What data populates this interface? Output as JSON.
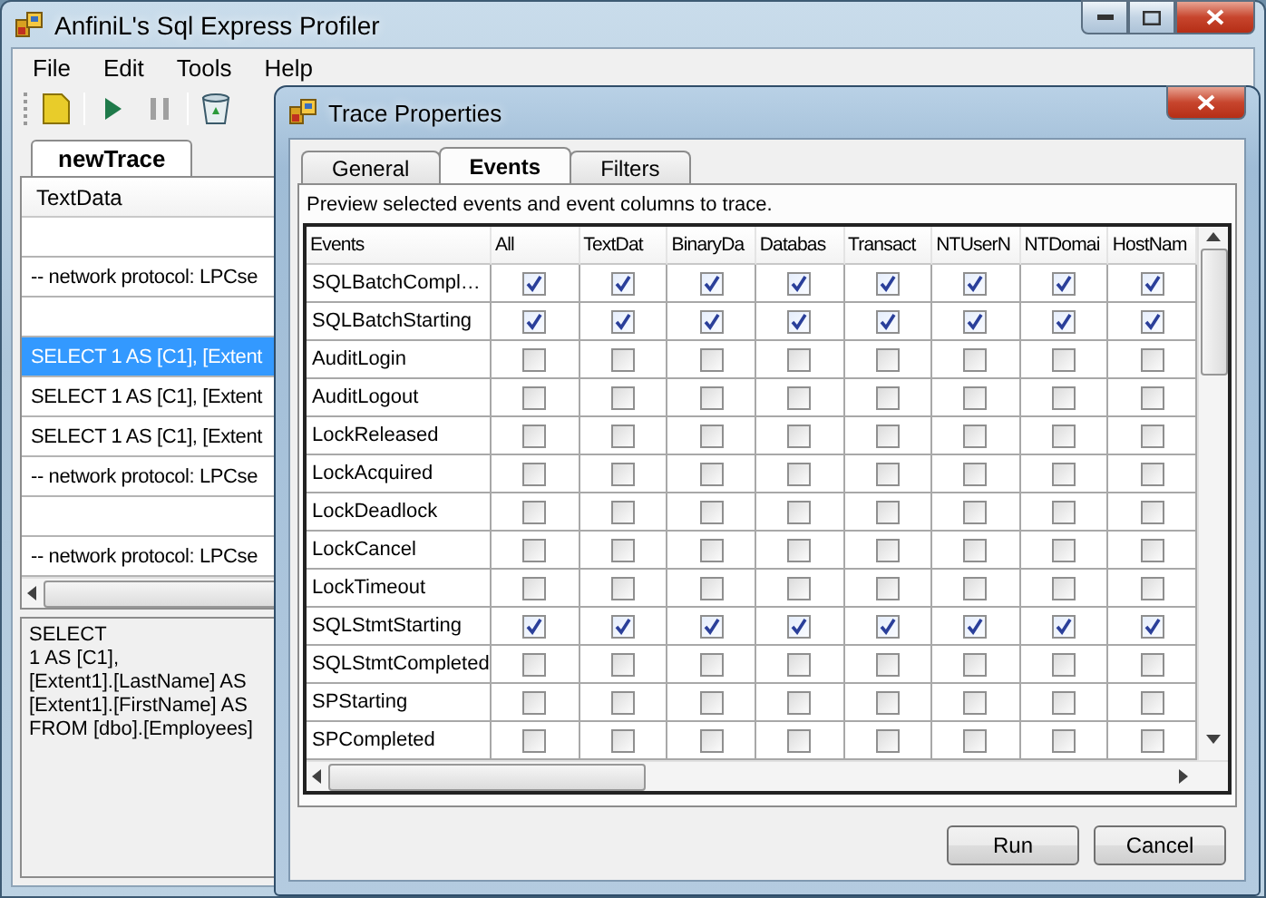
{
  "window": {
    "title": "AnfiniL's Sql Express Profiler"
  },
  "menu": [
    "File",
    "Edit",
    "Tools",
    "Help"
  ],
  "toolbar": [
    {
      "kind": "new",
      "disabled": false
    },
    {
      "kind": "run",
      "disabled": false
    },
    {
      "kind": "pause",
      "disabled": true
    },
    {
      "kind": "clear",
      "disabled": false
    }
  ],
  "trace_tab": {
    "label": "newTrace",
    "selected": true
  },
  "trace_grid": {
    "column": "TextData",
    "rows": [
      {
        "selected": false
      },
      {
        "text": "-- network protocol: LPCse",
        "selected": false
      },
      {
        "selected": false
      },
      {
        "text": "SELECT 1 AS [C1], [Extent",
        "selected": true
      },
      {
        "text": "SELECT 1 AS [C1], [Extent",
        "selected": false
      },
      {
        "text": "SELECT 1 AS [C1], [Extent",
        "selected": false
      },
      {
        "text": "-- network protocol: LPCse",
        "selected": false
      },
      {
        "selected": false
      },
      {
        "text": "-- network protocol: LPCse",
        "selected": false
      }
    ]
  },
  "detail_lines": [
    "SELECT",
    "1 AS [C1],",
    "[Extent1].[LastName] AS",
    "[Extent1].[FirstName] AS",
    "FROM [dbo].[Employees]"
  ],
  "dialog": {
    "title": "Trace Properties",
    "tabs": [
      {
        "label": "General",
        "selected": false
      },
      {
        "label": "Events",
        "selected": true
      },
      {
        "label": "Filters",
        "selected": false
      }
    ],
    "description": "Preview selected events and event columns to trace.",
    "columns": [
      "Events",
      "All",
      "TextDat",
      "BinaryDa",
      "Databas",
      "Transact",
      "NTUserN",
      "NTDomai",
      "HostNam"
    ],
    "events": [
      {
        "name": "SQLBatchCompl…",
        "checks": [
          true,
          true,
          true,
          true,
          true,
          true,
          true,
          true
        ]
      },
      {
        "name": "SQLBatchStarting",
        "checks": [
          true,
          true,
          true,
          true,
          true,
          true,
          true,
          true
        ]
      },
      {
        "name": "AuditLogin",
        "checks": [
          false,
          false,
          false,
          false,
          false,
          false,
          false,
          false
        ]
      },
      {
        "name": "AuditLogout",
        "checks": [
          false,
          false,
          false,
          false,
          false,
          false,
          false,
          false
        ]
      },
      {
        "name": "LockReleased",
        "checks": [
          false,
          false,
          false,
          false,
          false,
          false,
          false,
          false
        ]
      },
      {
        "name": "LockAcquired",
        "checks": [
          false,
          false,
          false,
          false,
          false,
          false,
          false,
          false
        ]
      },
      {
        "name": "LockDeadlock",
        "checks": [
          false,
          false,
          false,
          false,
          false,
          false,
          false,
          false
        ]
      },
      {
        "name": "LockCancel",
        "checks": [
          false,
          false,
          false,
          false,
          false,
          false,
          false,
          false
        ]
      },
      {
        "name": "LockTimeout",
        "checks": [
          false,
          false,
          false,
          false,
          false,
          false,
          false,
          false
        ]
      },
      {
        "name": "SQLStmtStarting",
        "checks": [
          true,
          true,
          true,
          true,
          true,
          true,
          true,
          true
        ]
      },
      {
        "name": "SQLStmtCompleted",
        "checks": [
          false,
          false,
          false,
          false,
          false,
          false,
          false,
          false
        ]
      },
      {
        "name": "SPStarting",
        "checks": [
          false,
          false,
          false,
          false,
          false,
          false,
          false,
          false
        ]
      },
      {
        "name": "SPCompleted",
        "checks": [
          false,
          false,
          false,
          false,
          false,
          false,
          false,
          false
        ]
      }
    ],
    "buttons": [
      "Run",
      "Cancel"
    ]
  }
}
